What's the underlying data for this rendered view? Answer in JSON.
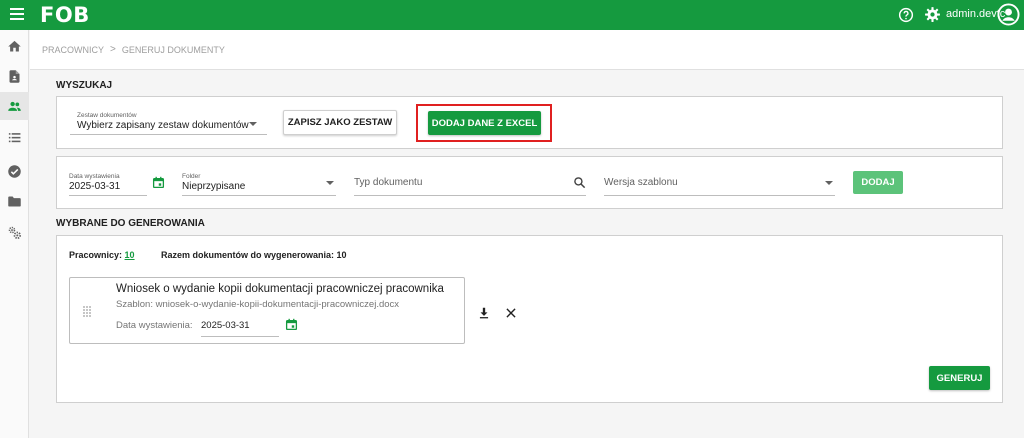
{
  "topbar": {
    "logo": "FOB",
    "username": "admin.devtc"
  },
  "breadcrumb": {
    "items": [
      "PRACOWNICY",
      "GENERUJ DOKUMENTY"
    ],
    "separator": ">"
  },
  "search_section": {
    "title": "WYSZUKAJ",
    "doc_set": {
      "label": "Zestaw dokumentów",
      "value": "Wybierz zapisany zestaw dokumentów"
    },
    "save_as_set_label": "ZAPISZ JAKO ZESTAW",
    "add_excel_label": "DODAJ DANE Z EXCEL",
    "filters": {
      "issue_date_label": "Data wystawienia",
      "issue_date_value": "2025-03-31",
      "folder_label": "Folder",
      "folder_value": "Nieprzypisane",
      "doc_type_placeholder": "Typ dokumentu",
      "template_version_placeholder": "Wersja szablonu",
      "add_label": "DODAJ"
    }
  },
  "selected_section": {
    "title": "WYBRANE DO GENEROWANIA",
    "employees_label": "Pracownicy:",
    "employees_count": "10",
    "total_docs_label": "Razem dokumentów do wygenerowania: 10",
    "document": {
      "title": "Wniosek o wydanie kopii dokumentacji pracowniczej pracownika",
      "template": "Szablon: wniosek-o-wydanie-kopii-dokumentacji-pracowniczej.docx",
      "date_label": "Data wystawienia:",
      "date_value": "2025-03-31"
    },
    "generate_label": "GENERUJ"
  },
  "colors": {
    "brand_green": "#159a3f",
    "highlight_red": "#e02020"
  },
  "icons": {
    "menu": "hamburger-icon",
    "help": "help-circle-icon",
    "settings": "gear-icon",
    "account": "account-circle-icon",
    "sidebar": [
      "home-icon",
      "document-icon",
      "people-icon",
      "list-icon",
      "check-circle-icon",
      "folder-icon",
      "settings-cogs-icon"
    ]
  }
}
